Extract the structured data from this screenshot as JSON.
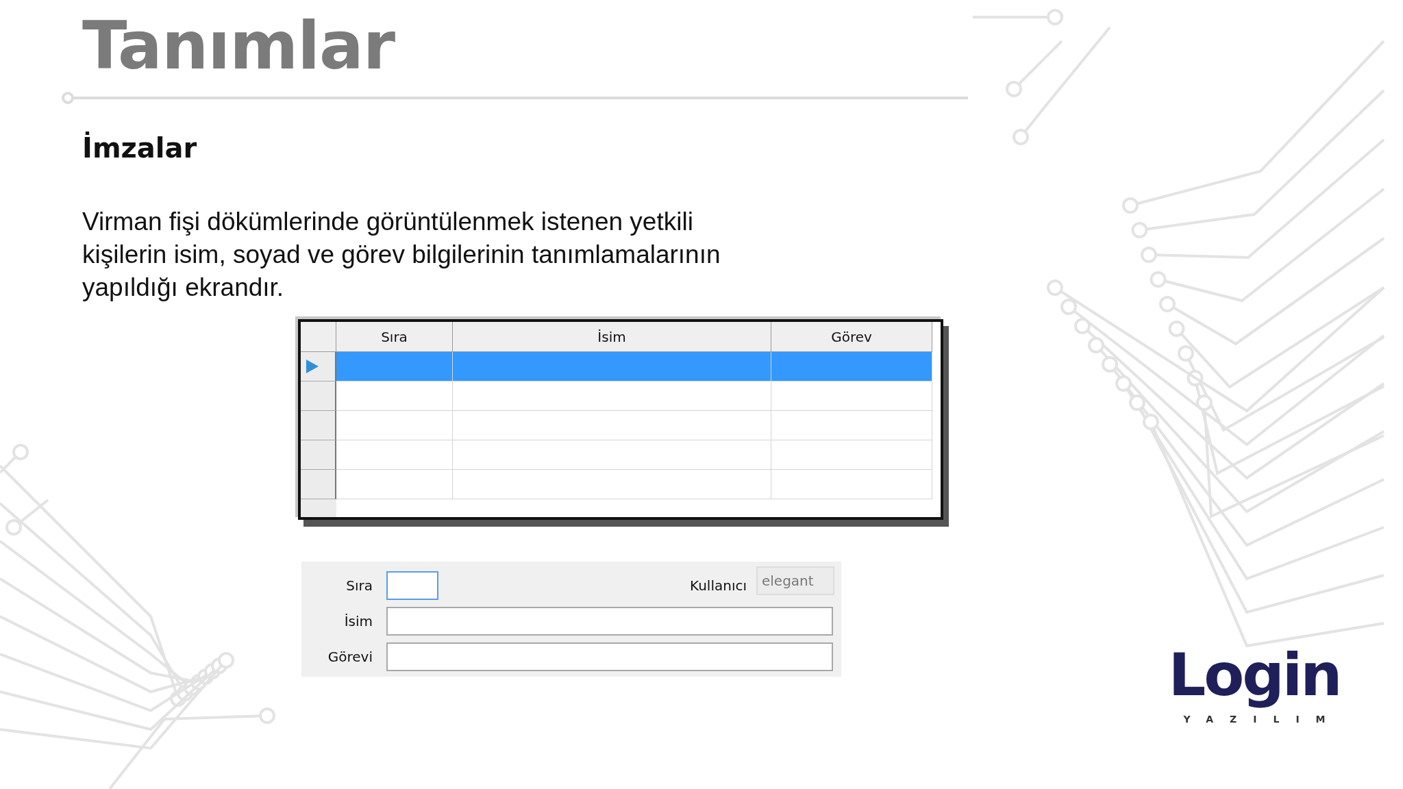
{
  "slide": {
    "title": "Tanımlar",
    "subtitle": "İmzalar",
    "description": "Virman fişi dökümlerinde görüntülenmek istenen yetkili kişilerin isim, soyad ve görev bilgilerinin tanımlamalarının yapıldığı ekrandır."
  },
  "grid": {
    "columns": [
      "Sıra",
      "İsim",
      "Görev"
    ],
    "rows": [
      {
        "selected": true
      },
      {
        "selected": false
      },
      {
        "selected": false
      },
      {
        "selected": false
      },
      {
        "selected": false
      }
    ]
  },
  "form": {
    "fields": [
      {
        "label": "Sıra",
        "focused": true
      },
      {
        "label": "İsim",
        "focused": false
      },
      {
        "label": "Görevi",
        "focused": false
      }
    ],
    "user": {
      "label": "Kullanıcı",
      "value": "elegant",
      "disabled": true
    }
  },
  "logo": {
    "name": "Login",
    "tagline": "YAZILIM"
  }
}
